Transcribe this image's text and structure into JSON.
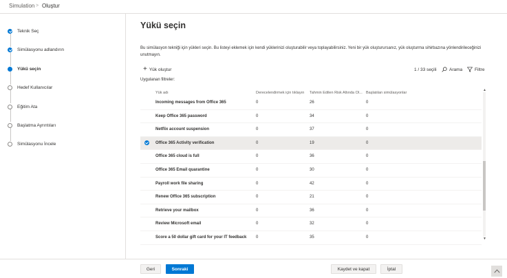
{
  "breadcrumb": {
    "root": "Simulation",
    "separator": ">",
    "current": "Oluştur"
  },
  "steps": [
    {
      "label": "Teknik Seç",
      "state": "done"
    },
    {
      "label": "Simülasyonu adlandırın",
      "state": "done"
    },
    {
      "label": "Yükü seçin",
      "state": "current"
    },
    {
      "label": "Hedef Kullanıcılar",
      "state": "todo"
    },
    {
      "label": "Eğitim Ata",
      "state": "todo"
    },
    {
      "label": "Başlatma Ayrıntıları",
      "state": "todo"
    },
    {
      "label": "Simülasyonu İncele",
      "state": "todo"
    }
  ],
  "page": {
    "title": "Yükü seçin",
    "description": "Bu simülasyon tekniği için yükleri seçin. Bu listeyi eklemek için kendi yüklerinizi oluşturabilir veya toplayabilirsiniz. Yeni bir yük oluşturursanız, yük oluşturma sihirbazına yönlendirileceğinizi unutmayın."
  },
  "toolbar": {
    "add_label": "Yük oluştur",
    "selected_count": "1 / 33 seçili",
    "search_label": "Arama",
    "filter_label": "Filtre"
  },
  "applied_filters": "Uygulanan filtreler:",
  "table": {
    "columns": [
      "Yük adı",
      "Derecelendirmek için tıklayın",
      "Tahmin Edilen Risk Altında Ol...",
      "Başlatılan simülasyonlar"
    ],
    "rows": [
      {
        "name": "Incoming messages from Office 365",
        "c1": "0",
        "c2": "26",
        "c3": "0",
        "selected": false
      },
      {
        "name": "Keep Office 365 password",
        "c1": "0",
        "c2": "34",
        "c3": "0",
        "selected": false
      },
      {
        "name": "Netflix account suspension",
        "c1": "0",
        "c2": "37",
        "c3": "0",
        "selected": false
      },
      {
        "name": "Office 365 Activity verification",
        "c1": "0",
        "c2": "19",
        "c3": "0",
        "selected": true
      },
      {
        "name": "Office 365 cloud is full",
        "c1": "0",
        "c2": "36",
        "c3": "0",
        "selected": false
      },
      {
        "name": "Office 365 Email quarantine",
        "c1": "0",
        "c2": "30",
        "c3": "0",
        "selected": false
      },
      {
        "name": "Payroll work file sharing",
        "c1": "0",
        "c2": "42",
        "c3": "0",
        "selected": false
      },
      {
        "name": "Renew Office 365 subscription",
        "c1": "0",
        "c2": "21",
        "c3": "0",
        "selected": false
      },
      {
        "name": "Retrieve your mailbox",
        "c1": "0",
        "c2": "36",
        "c3": "0",
        "selected": false
      },
      {
        "name": "Review Microsoft email",
        "c1": "0",
        "c2": "32",
        "c3": "0",
        "selected": false
      },
      {
        "name": "Score a 50 dollar gift card for your IT feedback",
        "c1": "0",
        "c2": "35",
        "c3": "0",
        "selected": false
      }
    ]
  },
  "footer": {
    "back_label": "Geri",
    "next_label": "Sonraki",
    "save_close_label": "Kaydet ve kapat",
    "cancel_label": "İptal"
  },
  "colors": {
    "accent": "#0078d4",
    "selected_row": "#edebe9"
  }
}
